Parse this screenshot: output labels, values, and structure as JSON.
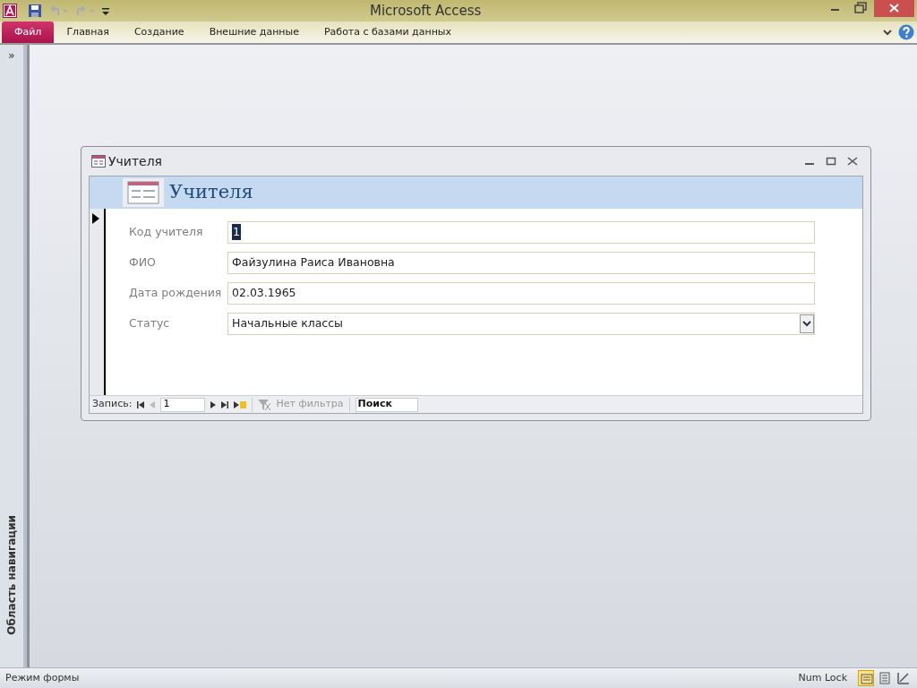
{
  "window": {
    "title": "Microsoft Access"
  },
  "ribbon_tabs": [
    {
      "label": "Файл",
      "kind": "file"
    },
    {
      "label": "Главная",
      "kind": "plain"
    },
    {
      "label": "Создание",
      "kind": "plain"
    },
    {
      "label": "Внешние данные",
      "kind": "plain"
    },
    {
      "label": "Работа с базами данных",
      "kind": "plain"
    }
  ],
  "navigation_pane": {
    "label": "Область навигации",
    "toggle": "»"
  },
  "form_window": {
    "title": "Учителя",
    "header": "Учителя",
    "fields": [
      {
        "label": "Код учителя",
        "value": "1",
        "kind": "text",
        "selected": true
      },
      {
        "label": "ФИО",
        "value": "Файзулина Раиса Ивановна",
        "kind": "text",
        "selected": false
      },
      {
        "label": "Дата рождения",
        "value": "02.03.1965",
        "kind": "text",
        "selected": false
      },
      {
        "label": "Статус",
        "value": "Начальные классы",
        "kind": "combo",
        "selected": false
      }
    ],
    "record_nav": {
      "label": "Запись:",
      "current": "1",
      "filter": "Нет фильтра",
      "filter_disabled": true,
      "search": {
        "placeholder": "Поиск"
      }
    }
  },
  "status_bar": {
    "mode": "Режим формы",
    "num_lock": "Num Lock",
    "views": [
      {
        "kind": "form",
        "selected": true
      },
      {
        "kind": "layout",
        "selected": false
      },
      {
        "kind": "design",
        "selected": false
      }
    ]
  }
}
